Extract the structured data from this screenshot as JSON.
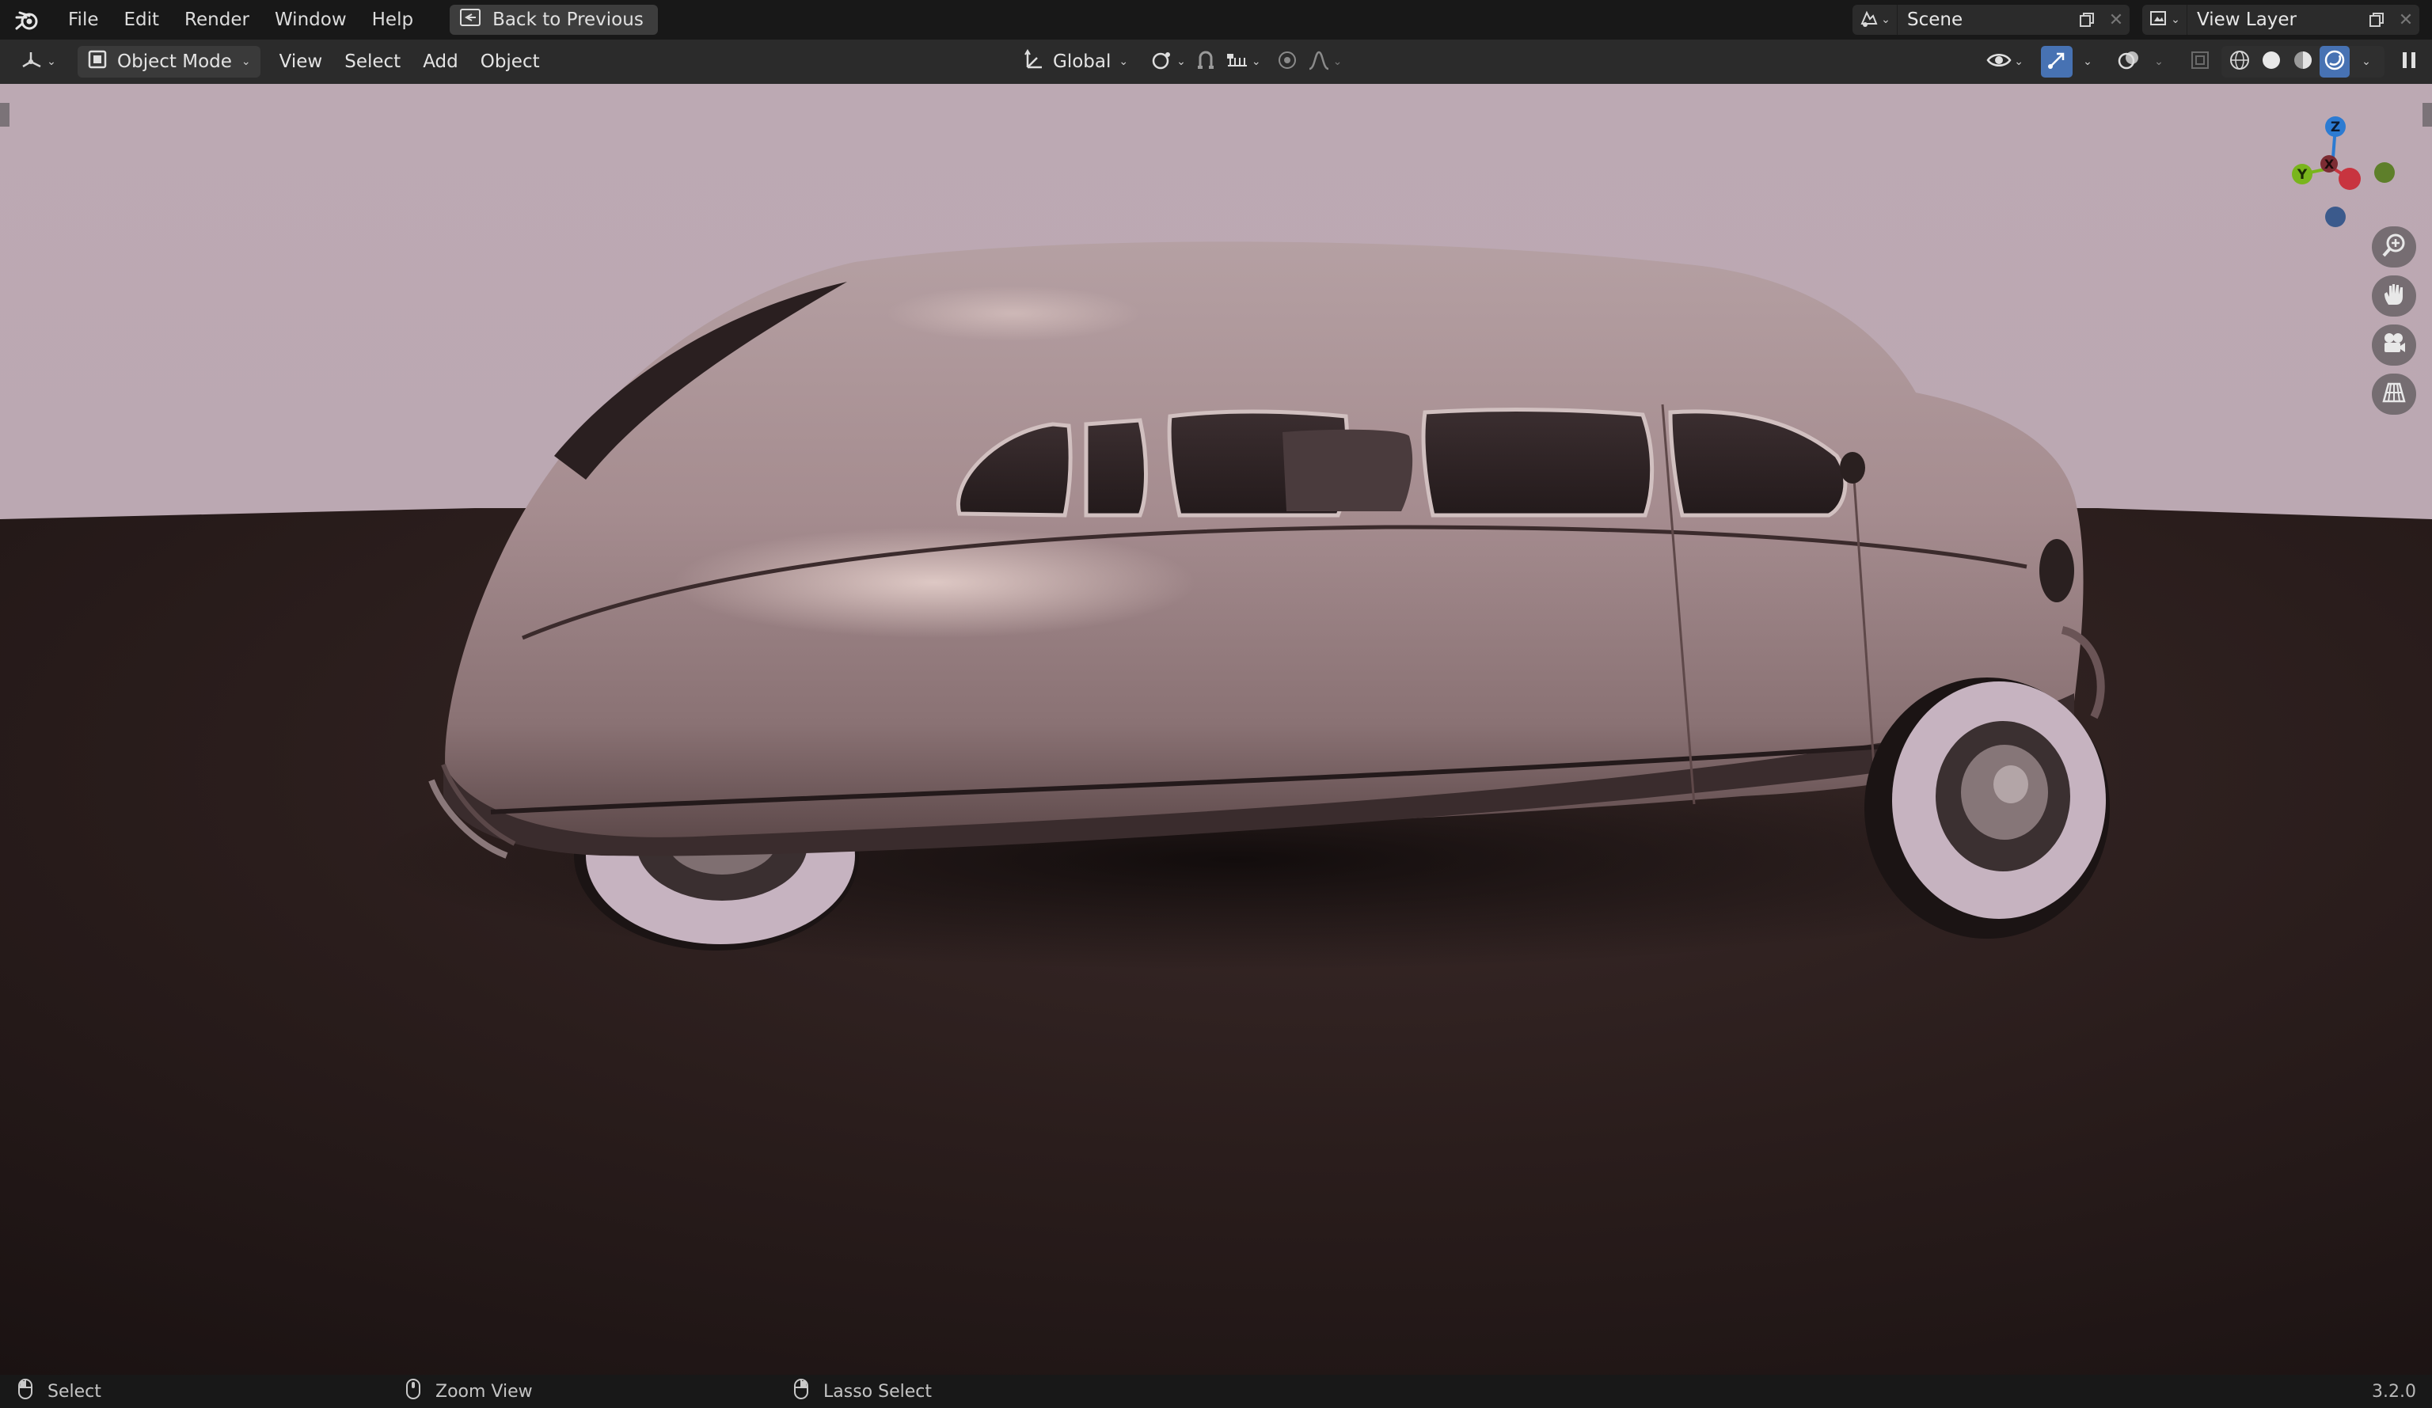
{
  "topbar": {
    "logo_icon": "blender-logo-icon",
    "menus": [
      "File",
      "Edit",
      "Render",
      "Window",
      "Help"
    ],
    "back_button": "Back to Previous",
    "scene": {
      "icon": "scene-icon",
      "value": "Scene"
    },
    "view_layer": {
      "icon": "view-layer-icon",
      "value": "View Layer"
    }
  },
  "header": {
    "editor_type_icon": "3d-viewport-icon",
    "mode": "Object Mode",
    "menus": [
      "View",
      "Select",
      "Add",
      "Object"
    ],
    "transform_orientation": "Global",
    "icons": [
      "pivot-icon",
      "snap-icon",
      "snap-increment-icon",
      "proportional-edit-icon",
      "falloff-icon"
    ],
    "right_icons": [
      "visibility-icon",
      "gizmo-icon",
      "overlay-icon",
      "xray-icon",
      "wireframe-shading-icon",
      "solid-shading-icon",
      "material-shading-icon",
      "rendered-shading-icon",
      "pause-icon"
    ],
    "active_shading": "rendered"
  },
  "viewport": {
    "gizmo_axes": {
      "z": "Z",
      "y": "Y",
      "x": "X"
    },
    "nav_buttons": [
      "zoom-icon",
      "pan-hand-icon",
      "camera-icon",
      "ortho-grid-icon"
    ]
  },
  "statusbar": {
    "items": [
      {
        "icon": "mouse-left-icon",
        "label": "Select"
      },
      {
        "icon": "mouse-middle-icon",
        "label": "Zoom View"
      },
      {
        "icon": "mouse-right-icon",
        "label": "Lasso Select"
      }
    ],
    "version": "3.2.0"
  },
  "colors": {
    "accent": "#4772b3",
    "axis_x": "#c8343f",
    "axis_y": "#79b51c",
    "axis_z": "#2c7bd2",
    "sky": "#bba8b2",
    "floor": "#241a1a",
    "car_body": "#a88f92"
  }
}
